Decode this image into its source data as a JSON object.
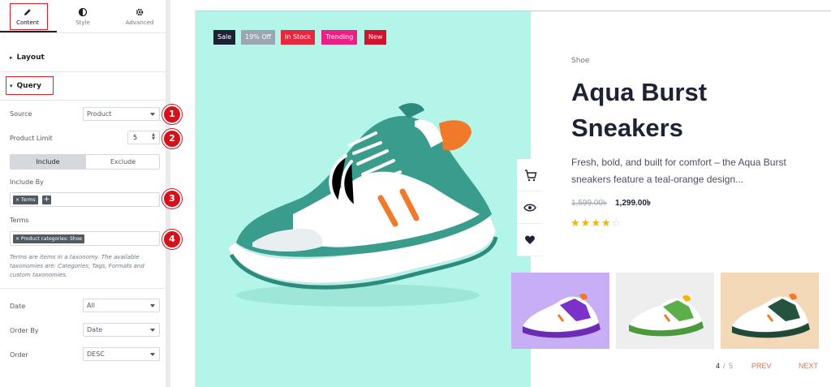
{
  "panel": {
    "tabs": [
      {
        "label": "Content",
        "icon": "pencil-icon"
      },
      {
        "label": "Style",
        "icon": "half-circle-icon"
      },
      {
        "label": "Advanced",
        "icon": "gear-icon"
      }
    ],
    "sections": {
      "layout": "Layout",
      "query": "Query"
    },
    "source": {
      "label": "Source",
      "value": "Product"
    },
    "product_limit": {
      "label": "Product Limit",
      "value": "5"
    },
    "include_exclude": {
      "include": "Include",
      "exclude": "Exclude"
    },
    "include_by": {
      "label": "Include By",
      "tag": "× Terms",
      "add": "+"
    },
    "terms": {
      "label": "Terms",
      "tag": "× Product categories: Shoe"
    },
    "help_text": "Terms are items in a taxonomy. The available taxonomies are: Categories, Tags, Formats and custom taxonomies.",
    "date": {
      "label": "Date",
      "value": "All"
    },
    "order_by": {
      "label": "Order By",
      "value": "Date"
    },
    "order": {
      "label": "Order",
      "value": "DESC"
    },
    "markers": [
      "1",
      "2",
      "3",
      "4"
    ]
  },
  "product": {
    "badges": [
      {
        "label": "Sale",
        "color": "#1d2235"
      },
      {
        "label": "19% Off",
        "color": "#9aa7b3"
      },
      {
        "label": "In Stock",
        "color": "#e8273f"
      },
      {
        "label": "Trending",
        "color": "#ee1e82"
      },
      {
        "label": "New",
        "color": "#d3122e"
      }
    ],
    "category": "Shoe",
    "title": "Aqua Burst Sneakers",
    "description": "Fresh, bold, and built for comfort – the Aqua Burst sneakers feature a teal-orange design...",
    "price_old": "1,599.00৳",
    "price_new": "1,299.00৳",
    "rating": 4,
    "rating_max": 5,
    "actions": [
      "cart-icon",
      "eye-icon",
      "heart-icon"
    ],
    "pager": {
      "current": "4",
      "sep": "/",
      "total": "5",
      "prev": "PREV",
      "next": "NEXT"
    },
    "thumbnails": [
      "purple-sneaker",
      "green-sneaker",
      "dark-green-sneaker"
    ]
  },
  "colors": {
    "accent_red": "#e11d2a",
    "hero_bg": "#b4f5ea",
    "pager_accent": "#e8703a"
  }
}
